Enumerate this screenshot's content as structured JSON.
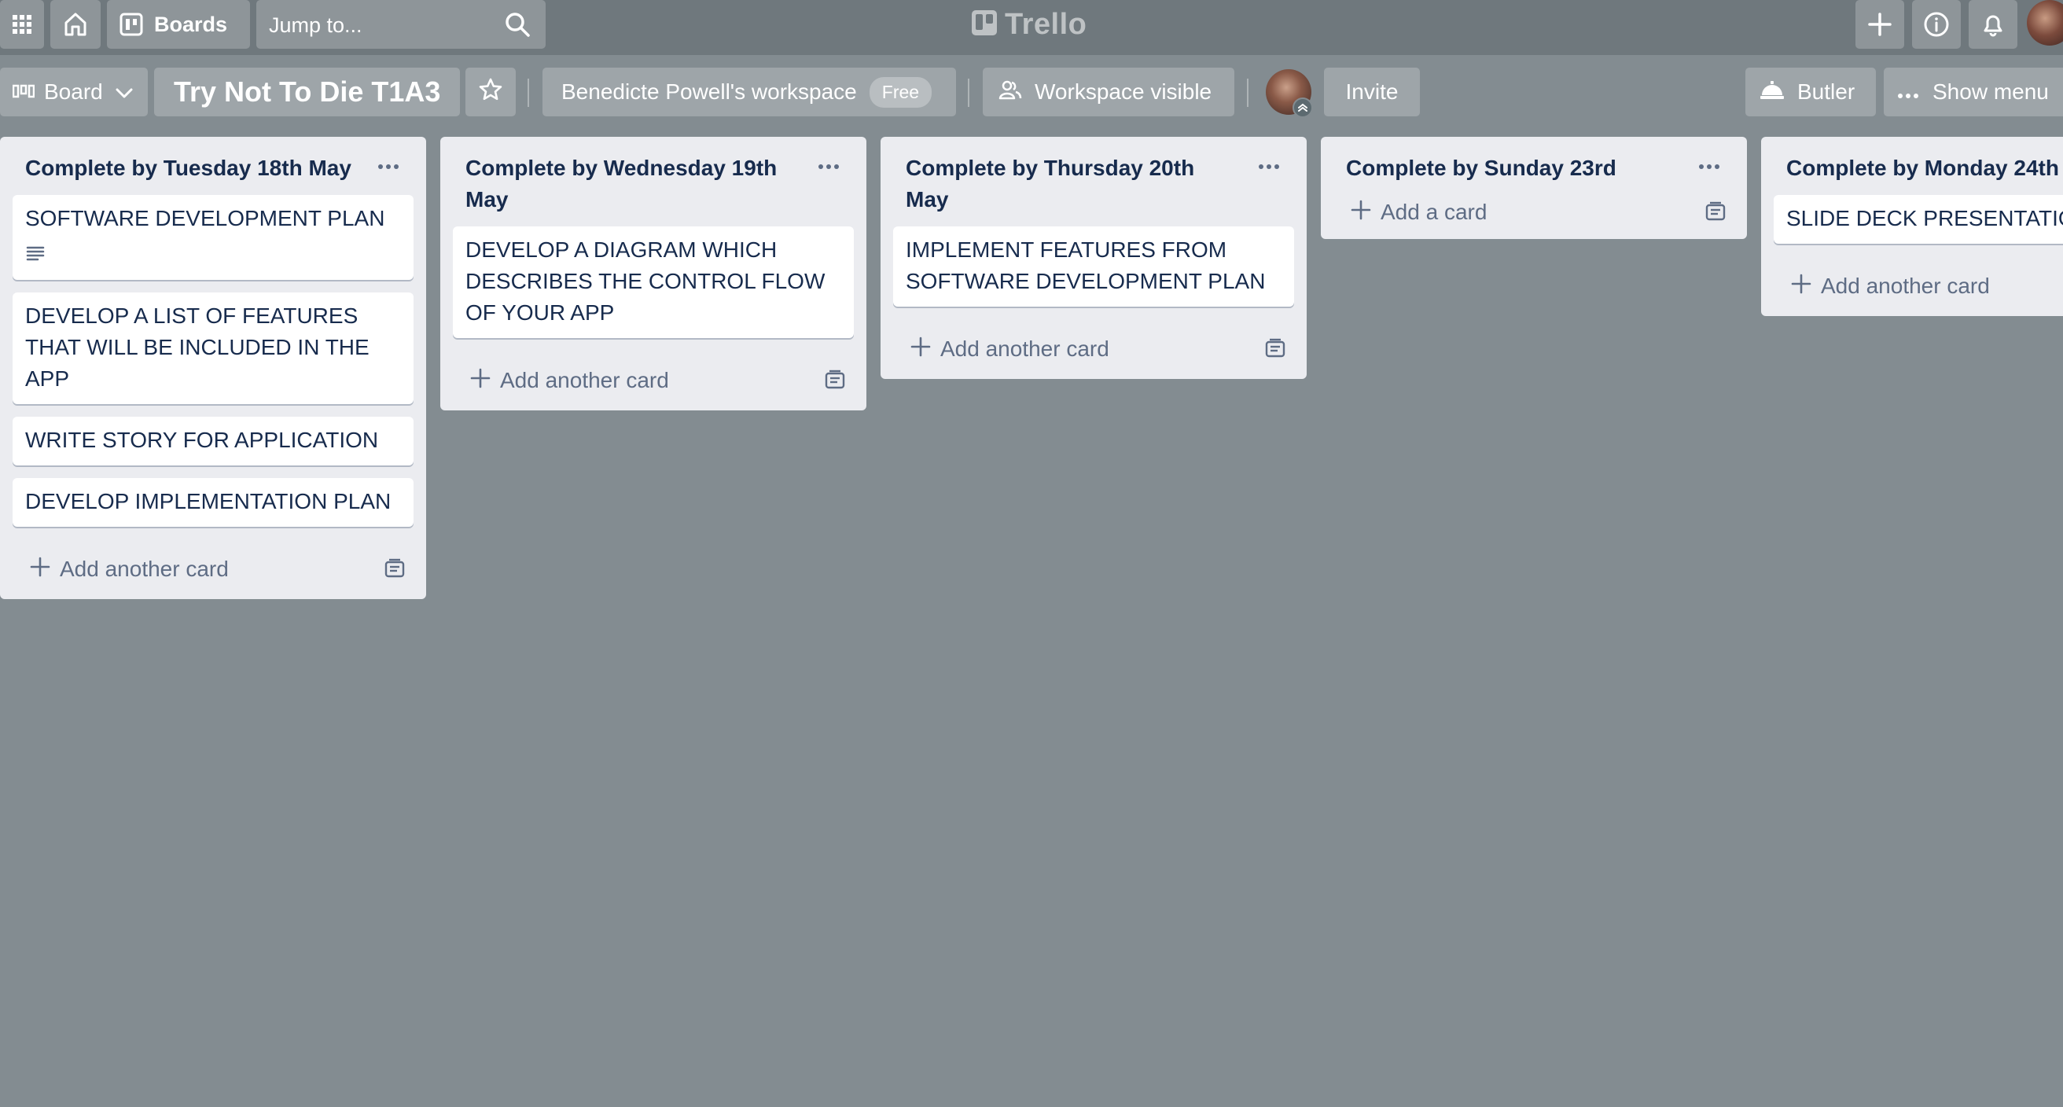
{
  "header": {
    "boards_label": "Boards",
    "search_placeholder": "Jump to...",
    "logo_text": "Trello"
  },
  "board": {
    "view_label": "Board",
    "title": "Try Not To Die T1A3",
    "workspace_name": "Benedicte Powell's workspace",
    "workspace_plan": "Free",
    "visibility_label": "Workspace visible",
    "invite_label": "Invite",
    "butler_label": "Butler",
    "show_menu_label": "Show menu"
  },
  "lists": [
    {
      "title": "Complete by Tuesday 18th May",
      "cards": [
        "SOFTWARE DEVELOPMENT PLAN",
        "DEVELOP A LIST OF FEATURES THAT WILL BE INCLUDED IN THE APP",
        "WRITE STORY FOR APPLICATION",
        "DEVELOP IMPLEMENTATION PLAN"
      ],
      "add_label": "Add another card"
    },
    {
      "title": "Complete by Wednesday 19th May",
      "cards": [
        "DEVELOP A DIAGRAM WHICH DESCRIBES THE CONTROL FLOW OF YOUR APP"
      ],
      "add_label": "Add another card"
    },
    {
      "title": "Complete by Thursday 20th May",
      "cards": [
        "IMPLEMENT FEATURES FROM SOFTWARE DEVELOPMENT PLAN"
      ],
      "add_label": "Add another card"
    },
    {
      "title": "Complete by Sunday 23rd",
      "cards": [],
      "add_label": "Add a card"
    },
    {
      "title": "Complete by Monday 24th",
      "cards": [
        "SLIDE DECK PRESENTATIO"
      ],
      "add_label": "Add another card"
    }
  ],
  "colors": {
    "board_background": "#838c91",
    "header_background": "#6f787d",
    "list_background": "#ebecf0",
    "card_background": "#ffffff",
    "text_primary": "#172b4d",
    "text_muted": "#5e6c84"
  },
  "icons": [
    "apps-grid-icon",
    "home-icon",
    "boards-icon",
    "search-icon",
    "trello-logo-icon",
    "plus-icon",
    "info-icon",
    "bell-icon",
    "board-view-icon",
    "chevron-down-icon",
    "star-icon",
    "visibility-icon",
    "butler-icon",
    "ellipsis-icon",
    "description-icon",
    "template-icon"
  ]
}
